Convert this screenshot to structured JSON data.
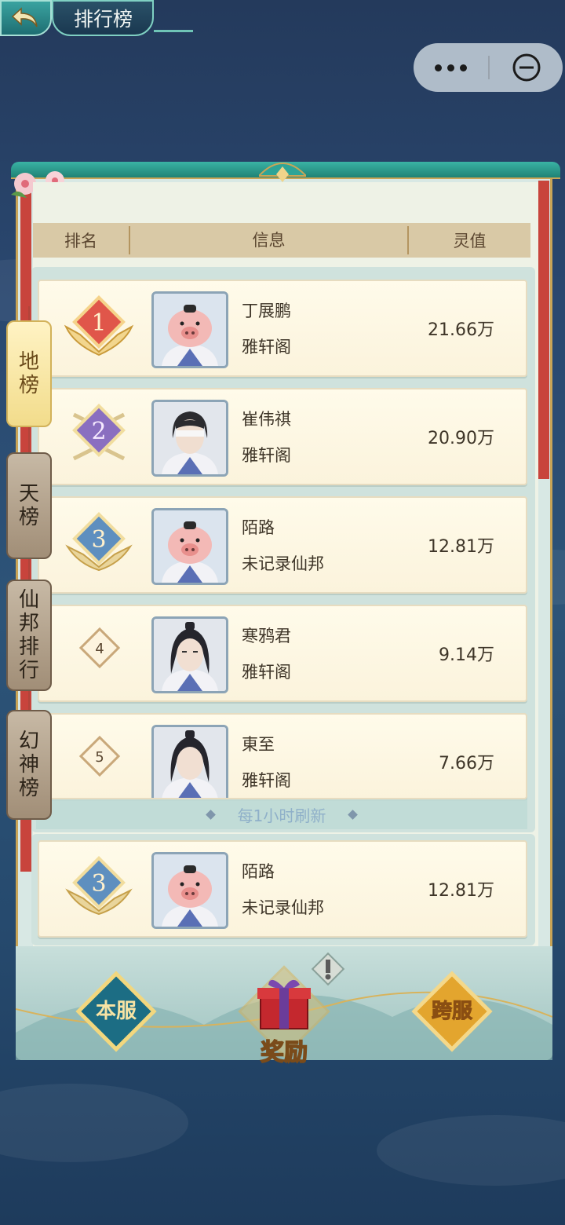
{
  "header": {
    "title": "排行榜"
  },
  "capsule": {
    "more_icon": "more-dots-icon",
    "close_icon": "minus-circle-icon"
  },
  "table": {
    "columns": [
      "排名",
      "信息",
      "灵值"
    ],
    "refresh_note": "每1小时刷新",
    "rows": [
      {
        "rank": "1",
        "name": "丁展鹏",
        "guild": "雅轩阁",
        "score": "21.66万",
        "avatar": "pig-avatar"
      },
      {
        "rank": "2",
        "name": "崔伟祺",
        "guild": "雅轩阁",
        "score": "20.90万",
        "avatar": "blindfold-avatar"
      },
      {
        "rank": "3",
        "name": "陌路",
        "guild": "未记录仙邦",
        "score": "12.81万",
        "avatar": "pig-avatar"
      },
      {
        "rank": "4",
        "name": "寒鸦君",
        "guild": "雅轩阁",
        "score": "9.14万",
        "avatar": "swordsman-avatar"
      },
      {
        "rank": "5",
        "name": "東至",
        "guild": "雅轩阁",
        "score": "7.66万",
        "avatar": "swordsman-avatar"
      }
    ],
    "self": {
      "rank": "3",
      "name": "陌路",
      "guild": "未记录仙邦",
      "score": "12.81万",
      "avatar": "pig-avatar"
    }
  },
  "side_tabs": [
    {
      "label": "地\n榜",
      "active": true
    },
    {
      "label": "天\n榜",
      "active": false
    },
    {
      "label": "仙\n邦\n排\n行",
      "active": false
    },
    {
      "label": "幻\n神\n榜",
      "active": false
    }
  ],
  "bottom": {
    "local_server": "本服",
    "reward": "奖励",
    "cross_server": "跨服"
  },
  "colors": {
    "gold": "#c9a557",
    "teal": "#1f8275",
    "red_rank": "#e0564a",
    "purple_rank": "#8a6fc0",
    "blue_rank": "#5e8fbf"
  }
}
